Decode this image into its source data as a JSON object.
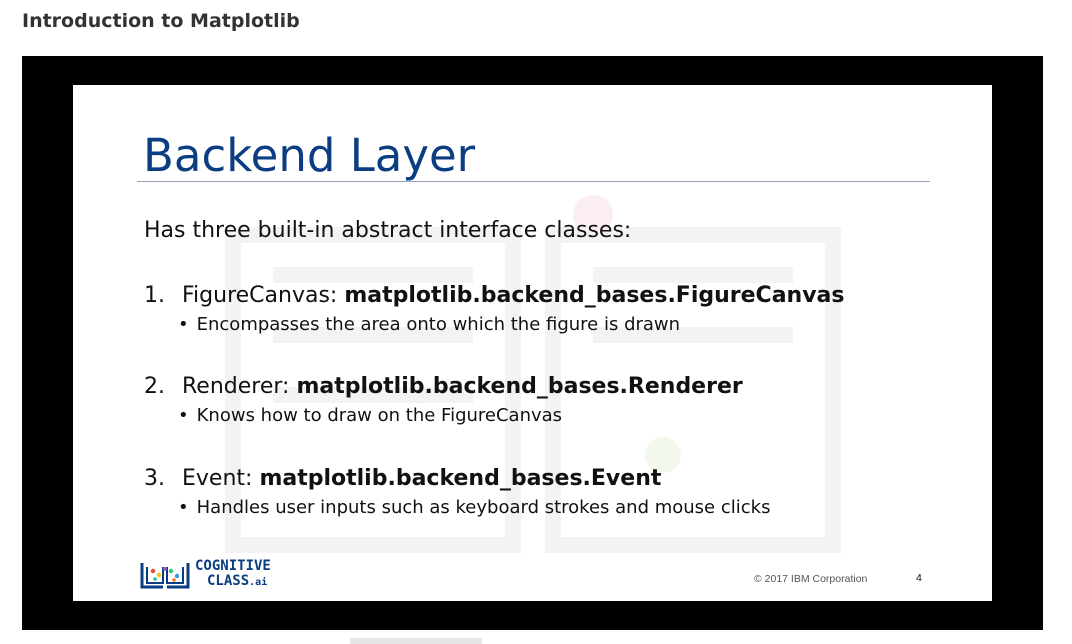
{
  "page": {
    "heading": "Introduction to Matplotlib"
  },
  "slide": {
    "title": "Backend Layer",
    "intro": "Has three built-in abstract interface classes:",
    "items": [
      {
        "number": "1.",
        "label": "FigureCanvas:",
        "code": "matplotlib.backend_bases.FigureCanvas",
        "description": "Encompasses the area onto which the figure is drawn"
      },
      {
        "number": "2.",
        "label": "Renderer:",
        "code": "matplotlib.backend_bases.Renderer",
        "description": "Knows how to draw on the FigureCanvas"
      },
      {
        "number": "3.",
        "label": "Event:",
        "code": "matplotlib.backend_bases.Event",
        "description": "Handles user inputs such as keyboard strokes and mouse clicks"
      }
    ],
    "logo": {
      "line1": "COGNITIVE",
      "line2": "CLASS",
      "suffix": ".ai"
    },
    "copyright": "© 2017 IBM Corporation",
    "page_number": "4"
  },
  "colors": {
    "title": "#0b3d82",
    "frame": "#000000",
    "heading": "#333333"
  },
  "icons": {
    "logo": "cognitive-class-logo-icon"
  }
}
